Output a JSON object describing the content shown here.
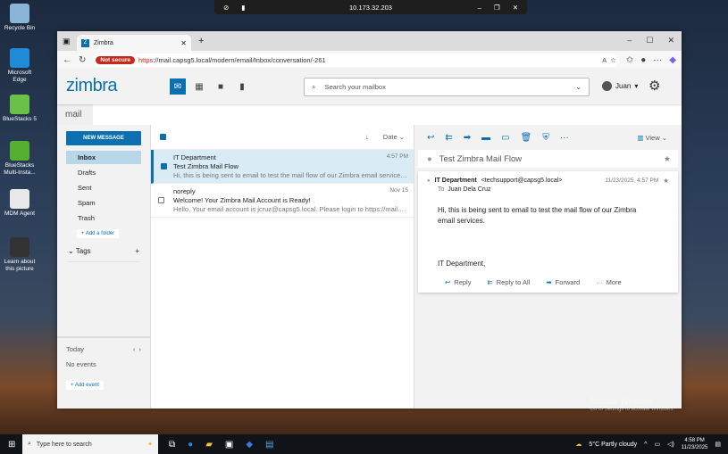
{
  "remote": {
    "ip": "10.173.32.203"
  },
  "desktop": [
    {
      "label": "Recycle Bin",
      "color": "#8ab4d8"
    },
    {
      "label": "Microsoft Edge",
      "color": "#1f8ad8"
    },
    {
      "label": "BlueStacks 5",
      "color": "#6bc04a"
    },
    {
      "label": "BlueStacks Multi-Insta...",
      "color": "#55b030"
    },
    {
      "label": "MDM Agent",
      "color": "#e8e8e8"
    },
    {
      "label": "Learn about this picture",
      "color": "#333"
    }
  ],
  "browser": {
    "tab": "Zimbra",
    "not_secure": "Not secure",
    "url_scheme": "https",
    "url_rest": "://mail.capsg5.local/modern/email/Inbox/conversation/-261"
  },
  "header": {
    "logo": "zimbra",
    "search_placeholder": "Search your mailbox",
    "user": "Juan"
  },
  "app_label": "mail",
  "sidebar": {
    "new_message": "NEW MESSAGE",
    "folders": [
      "Inbox",
      "Drafts",
      "Sent",
      "Spam",
      "Trash"
    ],
    "add_folder": "+ Add a folder",
    "tags": "Tags",
    "today": "Today",
    "no_events": "No events",
    "add_event": "+ Add event"
  },
  "list": {
    "sort": "Date",
    "items": [
      {
        "from": "IT Department",
        "subject": "Test Zimbra Mail Flow",
        "preview": "Hi, this is being sent to email to test the mail flow of our Zimbra email services. ...",
        "time": "4:57 PM",
        "selected": true
      },
      {
        "from": "noreply",
        "subject": "Welcome! Your Zimbra Mail Account is Ready!",
        "preview": "Hello, Your email account is jcruz@capsg5.local. Please login to https://mail.ca...",
        "time": "Nov 15",
        "selected": false
      }
    ]
  },
  "reader": {
    "view": "View",
    "subject": "Test Zimbra Mail Flow",
    "from_name": "IT Department",
    "from_email": "<techsupport@capsg5.local>",
    "date": "11/23/2025, 4:57 PM",
    "to_label": "To",
    "to": "Juan Dela Cruz",
    "body1": "Hi, this is being sent to email to test the mail flow of our Zimbra email services.",
    "body2": "IT Department,",
    "actions": [
      "Reply",
      "Reply to All",
      "Forward",
      "More"
    ]
  },
  "watermark": {
    "line1": "Activate Windows",
    "line2": "Go to Settings to activate Windows."
  },
  "taskbar": {
    "search": "Type here to search",
    "weather": "5°C  Partly cloudy",
    "time": "4:58 PM",
    "date": "11/23/2025"
  },
  "accent": "#0b6fb0"
}
